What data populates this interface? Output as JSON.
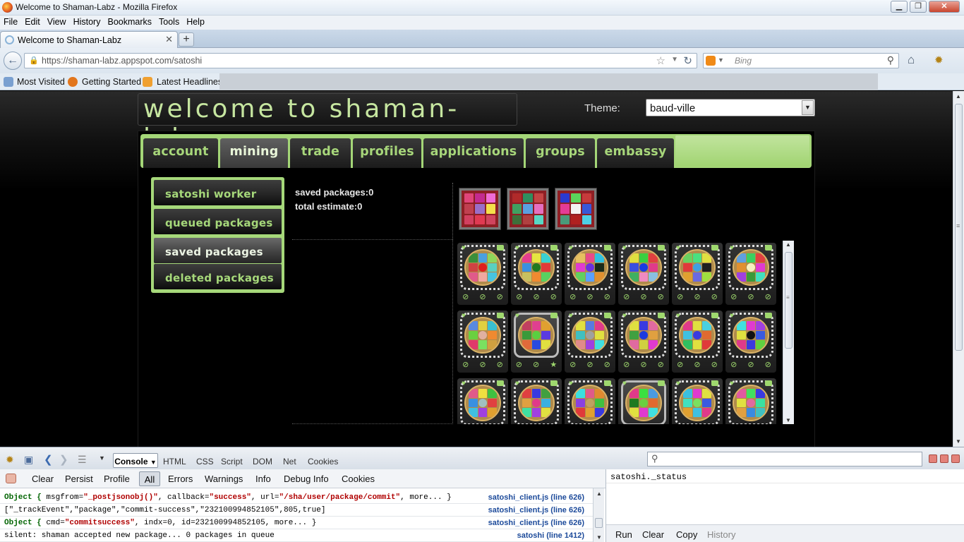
{
  "window": {
    "title": "Welcome to Shaman-Labz - Mozilla Firefox",
    "min": "▁",
    "max": "❐",
    "close": "✕"
  },
  "menu": [
    "File",
    "Edit",
    "View",
    "History",
    "Bookmarks",
    "Tools",
    "Help"
  ],
  "tab": {
    "label": "Welcome to Shaman-Labz",
    "close": "✕",
    "new": "+"
  },
  "nav": {
    "url": "https://shaman-labz.appspot.com/satoshi",
    "search_placeholder": "Bing"
  },
  "bookmarks": [
    "Most Visited",
    "Getting Started",
    "Latest Headlines"
  ],
  "site": {
    "banner": "welcome to shaman-labz",
    "theme_label": "Theme:",
    "theme_value": "baud-ville",
    "nav_tabs": [
      "account",
      "mining",
      "trade",
      "profiles",
      "applications",
      "groups",
      "embassy"
    ],
    "active_tab": "mining",
    "side_menu": [
      "satoshi worker",
      "queued packages",
      "saved packages",
      "deleted packages"
    ],
    "active_side": "saved packages",
    "saved_packages": "saved packages:0",
    "total_estimate": "total estimate:0",
    "status_glyphs": "⊘ ⊘ ⊘",
    "status_glyphs_star": "⊘ ⊘ ★",
    "accent": "#a6d87a"
  },
  "previews": [
    [
      "#e0457a",
      "#c32a8f",
      "#f06cd6",
      "#c04050",
      "#9a6ec8",
      "#f4e04a",
      "#d24060",
      "#e03a52",
      "#d0455e"
    ],
    [
      "#b02a2a",
      "#2f8f5f",
      "#c34545",
      "#40a060",
      "#5aa0e0",
      "#e56fc0",
      "#3e6f3a",
      "#b04040",
      "#58d7c4"
    ],
    [
      "#2a3ad0",
      "#5bd35b",
      "#c63b3b",
      "#e43b96",
      "#f3f3f3",
      "#3858d8",
      "#4a9a7a",
      "#b02020",
      "#4ed0e6"
    ]
  ],
  "tiles": [
    {
      "selected": false,
      "c": [
        "#3b8f3b",
        "#4aa0e0",
        "#8fd65a",
        "#d04242",
        "#e01e1e",
        "#5ad0c0",
        "#e05a8a",
        "#f0a8a0",
        "#48c4e0"
      ]
    },
    {
      "selected": false,
      "c": [
        "#e53e8e",
        "#e6e640",
        "#3ad0d0",
        "#3a90e0",
        "#207a20",
        "#e03a3a",
        "#c8c060",
        "#f08a30",
        "#5ad060"
      ]
    },
    {
      "selected": false,
      "c": [
        "#e6c060",
        "#e84a8a",
        "#30c0e0",
        "#e03ad0",
        "#6a30e0",
        "#1a2a1a",
        "#60d060",
        "#5aa0ff",
        "#e09030"
      ]
    },
    {
      "selected": false,
      "c": [
        "#e0e040",
        "#3ad040",
        "#e04040",
        "#3a50e0",
        "#1a3ae0",
        "#e03a8a",
        "#40b060",
        "#f08ac0",
        "#8ac0e0"
      ]
    },
    {
      "selected": false,
      "c": [
        "#6ad060",
        "#4ae080",
        "#e0e040",
        "#e03a3a",
        "#40a0e0",
        "#202020",
        "#e0a030",
        "#6a6ae0",
        "#a0e040"
      ]
    },
    {
      "selected": false,
      "c": [
        "#60a0e0",
        "#3ad060",
        "#e04040",
        "#e09030",
        "#f8f0c0",
        "#e03ad0",
        "#a040e0",
        "#3a9a3a",
        "#40e0c0"
      ]
    },
    {
      "selected": false,
      "c": [
        "#5a8ae0",
        "#e0d040",
        "#3ac0d0",
        "#6ad040",
        "#e0b0a0",
        "#f08a30",
        "#e03a6a",
        "#7ae060",
        "#d0a040"
      ]
    },
    {
      "selected": true,
      "c": [
        "#c04060",
        "#e04090",
        "#e0a030",
        "#3a9a3a",
        "#5ad040",
        "#5a3ae0",
        "#e06a3a",
        "#2a4ae0",
        "#e0e040"
      ]
    },
    {
      "selected": false,
      "c": [
        "#e0e040",
        "#5a7ae0",
        "#e03a8a",
        "#40c0c0",
        "#a0a0a0",
        "#e0e040",
        "#e08a8a",
        "#a040e0",
        "#40e0e0"
      ]
    },
    {
      "selected": false,
      "c": [
        "#e0e040",
        "#3a3ae0",
        "#e06aa0",
        "#40a040",
        "#1a3ae0",
        "#e0a040",
        "#e06aa0",
        "#d0d040",
        "#e03ad0"
      ]
    },
    {
      "selected": false,
      "c": [
        "#e03a8a",
        "#e0e040",
        "#4ad0e0",
        "#40c0e0",
        "#3a3ae0",
        "#e06a30",
        "#30c060",
        "#e0e040",
        "#e03a3a"
      ]
    },
    {
      "selected": false,
      "c": [
        "#40e0e0",
        "#e03ad0",
        "#a040e0",
        "#e0e040",
        "#111111",
        "#3a5ae0",
        "#e03a8a",
        "#3a3ae0",
        "#60d040"
      ]
    },
    {
      "selected": false,
      "c": [
        "#e05a8a",
        "#f0e040",
        "#40c040",
        "#3a90e0",
        "#a0c0c0",
        "#e04040",
        "#40c0e0",
        "#a040e0",
        "#e0a030"
      ]
    },
    {
      "selected": false,
      "c": [
        "#e04040",
        "#3a3ae0",
        "#40a040",
        "#e0a040",
        "#e03a8a",
        "#3ab0e0",
        "#40e0a0",
        "#a040e0",
        "#e0e040"
      ]
    },
    {
      "selected": false,
      "c": [
        "#3ae0e0",
        "#e05a8a",
        "#e08a30",
        "#8a40e0",
        "#c0a060",
        "#40c040",
        "#e03a3a",
        "#e0a030",
        "#3a3ae0"
      ]
    },
    {
      "selected": true,
      "c": [
        "#e03a8a",
        "#3ae040",
        "#4a9ae0",
        "#207a20",
        "#6ad040",
        "#e06a30",
        "#e0e040",
        "#e03ad0",
        "#40e0e0"
      ]
    },
    {
      "selected": false,
      "c": [
        "#3ac0e0",
        "#e03ad0",
        "#e0e040",
        "#40e0c0",
        "#7ae060",
        "#3a5ae0",
        "#e0a030",
        "#40c0e0",
        "#e03a8a"
      ]
    },
    {
      "selected": false,
      "c": [
        "#e05aa0",
        "#40e060",
        "#3a3ae0",
        "#e0e040",
        "#e06aa0",
        "#3ae0a0",
        "#e0a040",
        "#3a8ae0",
        "#40c0c0"
      ]
    }
  ],
  "firebug": {
    "tabs": [
      "Console",
      "HTML",
      "CSS",
      "Script",
      "DOM",
      "Net",
      "Cookies"
    ],
    "filters": [
      "Clear",
      "Persist",
      "Profile",
      "All",
      "Errors",
      "Warnings",
      "Info",
      "Debug Info",
      "Cookies"
    ],
    "log": [
      {
        "a": "Object { ",
        "b": "msgfrom=",
        "c": "\"_postjsonobj()\"",
        "d": ",  callback=",
        "e": "\"success\"",
        "f": ",  url=",
        "g": "\"/sha/user/package/commit\"",
        "h": ",  more... }",
        "src": "satoshi_client.js (line 626)"
      },
      {
        "plain": "[\"_trackEvent\",\"package\",\"commit-success\",\"232100994852105\",805,true]",
        "src": "satoshi_client.js (line 626)"
      },
      {
        "a": "Object { ",
        "b": "cmd=",
        "c": "\"commitsuccess\"",
        "d": ",  indx=0,  id=232100994852105,  more... }",
        "src": "satoshi_client.js (line 626)"
      },
      {
        "plain": "silent: shaman accepted new package... 0 packages in queue",
        "src": "satoshi (line 1412)"
      }
    ],
    "cmd_text": "satoshi._status",
    "cmd_buttons": [
      "Run",
      "Clear",
      "Copy",
      "History"
    ]
  }
}
